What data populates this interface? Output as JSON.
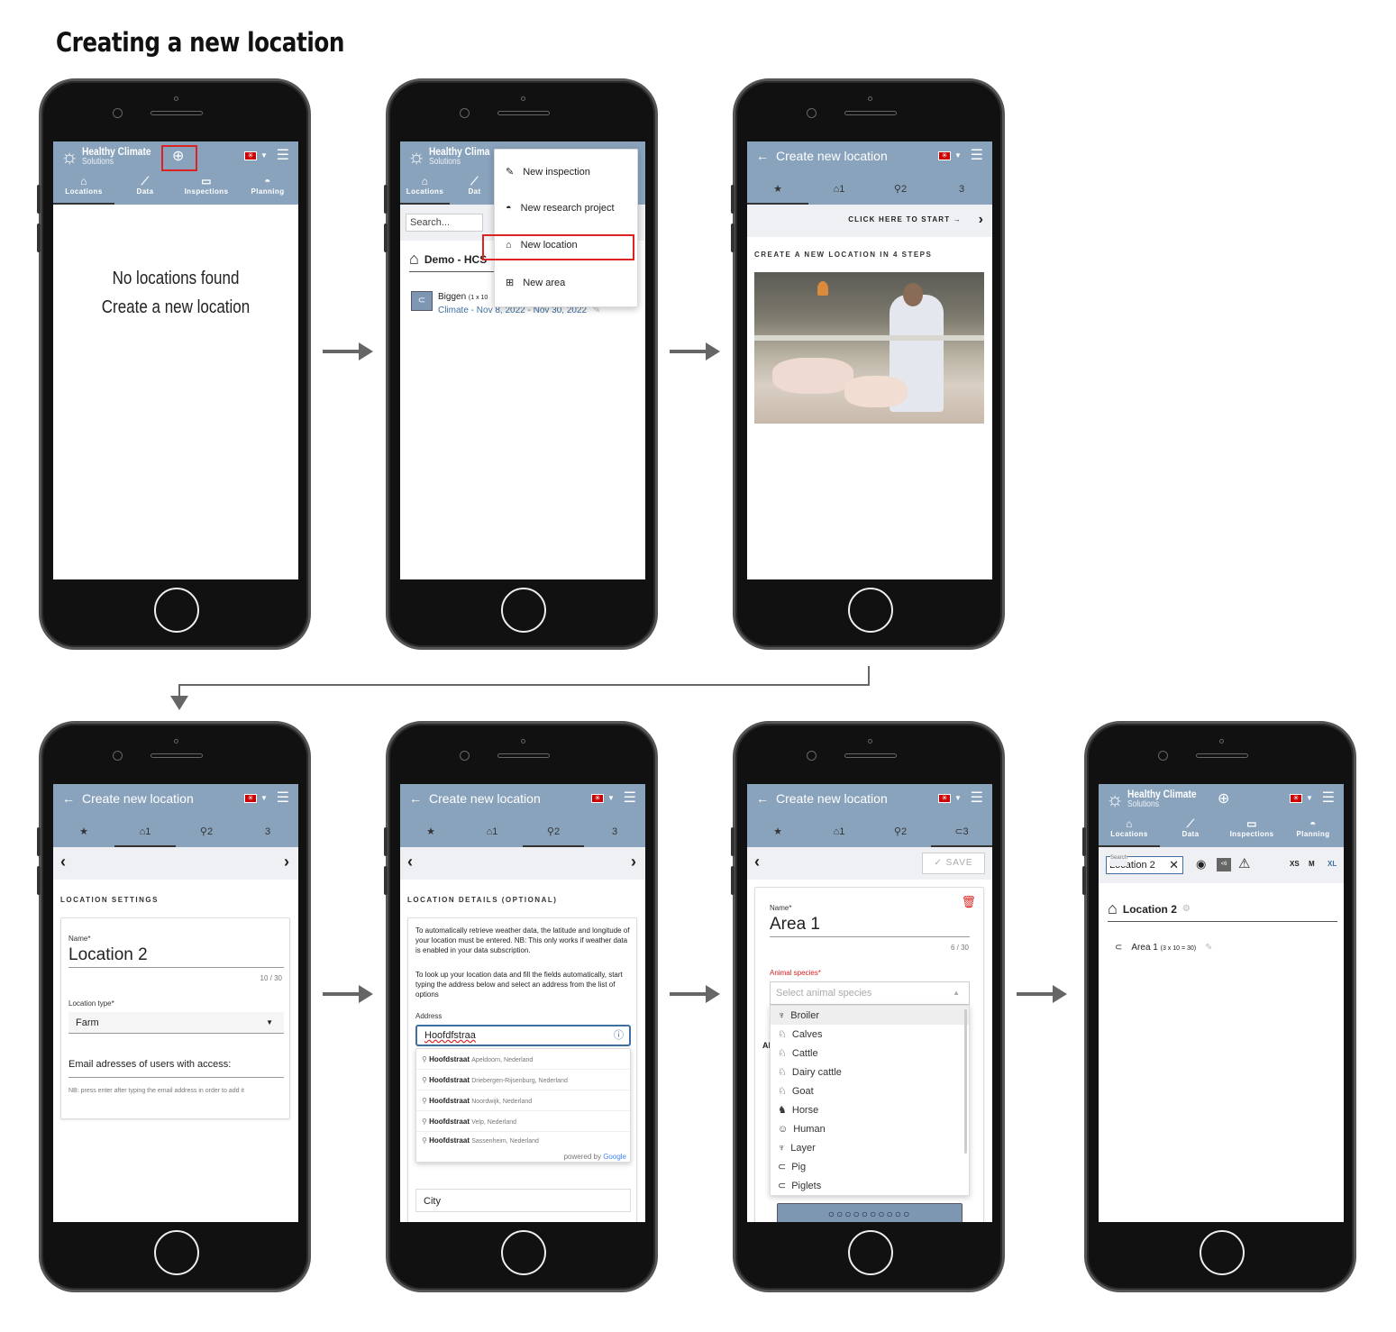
{
  "page_title": "Creating a new location",
  "common": {
    "brand_title": "Healthy Climate",
    "brand_subtitle": "Solutions",
    "nav": [
      "Locations",
      "Data",
      "Inspections",
      "Planning"
    ],
    "create_title": "Create new location",
    "step_labels": [
      "1",
      "2",
      "3"
    ]
  },
  "screen1": {
    "empty_line1": "No locations found",
    "empty_line2": "Create a new location"
  },
  "screen2": {
    "brand_title_cut": "Healthy Clima",
    "nav_cut": [
      "Locations",
      "Dat"
    ],
    "search_placeholder": "Search...",
    "group_title": "Demo - HCS",
    "item_name": "Biggen",
    "item_dims": "(1 x 10",
    "item_period": "Climate - Nov 8, 2022 - Nov 30, 2022",
    "menu": [
      "New inspection",
      "New research project",
      "New location",
      "New area"
    ]
  },
  "screen3": {
    "cta": "CLICK HERE TO START",
    "heading": "CREATE A NEW LOCATION IN 4 STEPS"
  },
  "screen4": {
    "section": "LOCATION SETTINGS",
    "name_label": "Name*",
    "name_value": "Location 2",
    "name_counter": "10 / 30",
    "type_label": "Location type*",
    "type_value": "Farm",
    "emails_label": "Email adresses of users with access:",
    "emails_hint": "NB: press enter after typing the email address in order to add it"
  },
  "screen5": {
    "section": "LOCATION DETAILS (OPTIONAL)",
    "info1": "To automatically retrieve weather data, the latitude and longitude of your location must be entered. NB: This only works if weather data is enabled in your data subscription.",
    "info2": "To look up your location data and fill the fields automatically, start typing the address below and select an address from the list of options",
    "address_label": "Address",
    "address_value": "Hoofdfstraa",
    "suggestions": [
      {
        "main": "Hoofdstraat",
        "sub": "Apeldoorn, Nederland"
      },
      {
        "main": "Hoofdstraat",
        "sub": "Driebergen-Rijsenburg, Nederland"
      },
      {
        "main": "Hoofdstraat",
        "sub": "Noordwijk, Nederland"
      },
      {
        "main": "Hoofdstraat",
        "sub": "Velp, Nederland"
      },
      {
        "main": "Hoofdstraat",
        "sub": "Sassenheim, Nederland"
      }
    ],
    "powered_by": "powered by",
    "google": "Google",
    "city_placeholder": "City"
  },
  "screen6": {
    "save": "SAVE",
    "name_label": "Name*",
    "name_value": "Area 1",
    "name_counter": "6 / 30",
    "species_label": "Animal species*",
    "species_placeholder": "Select animal species",
    "species": [
      "Broiler",
      "Calves",
      "Cattle",
      "Dairy cattle",
      "Goat",
      "Horse",
      "Human",
      "Layer",
      "Pig",
      "Piglets"
    ],
    "cut_label": "Al"
  },
  "screen7": {
    "search_label": "Search",
    "search_value": "Location 2",
    "size_options": [
      "XS",
      "M",
      "XL"
    ],
    "location_title": "Location 2",
    "area_name": "Area 1",
    "area_dims": "(3 x 10 = 30)",
    "badge": "<6"
  },
  "colors": {
    "appbar": "#8aa3bd",
    "highlight": "#dd2222",
    "link_blue": "#3f6fa0",
    "phone_body": "#111111"
  }
}
